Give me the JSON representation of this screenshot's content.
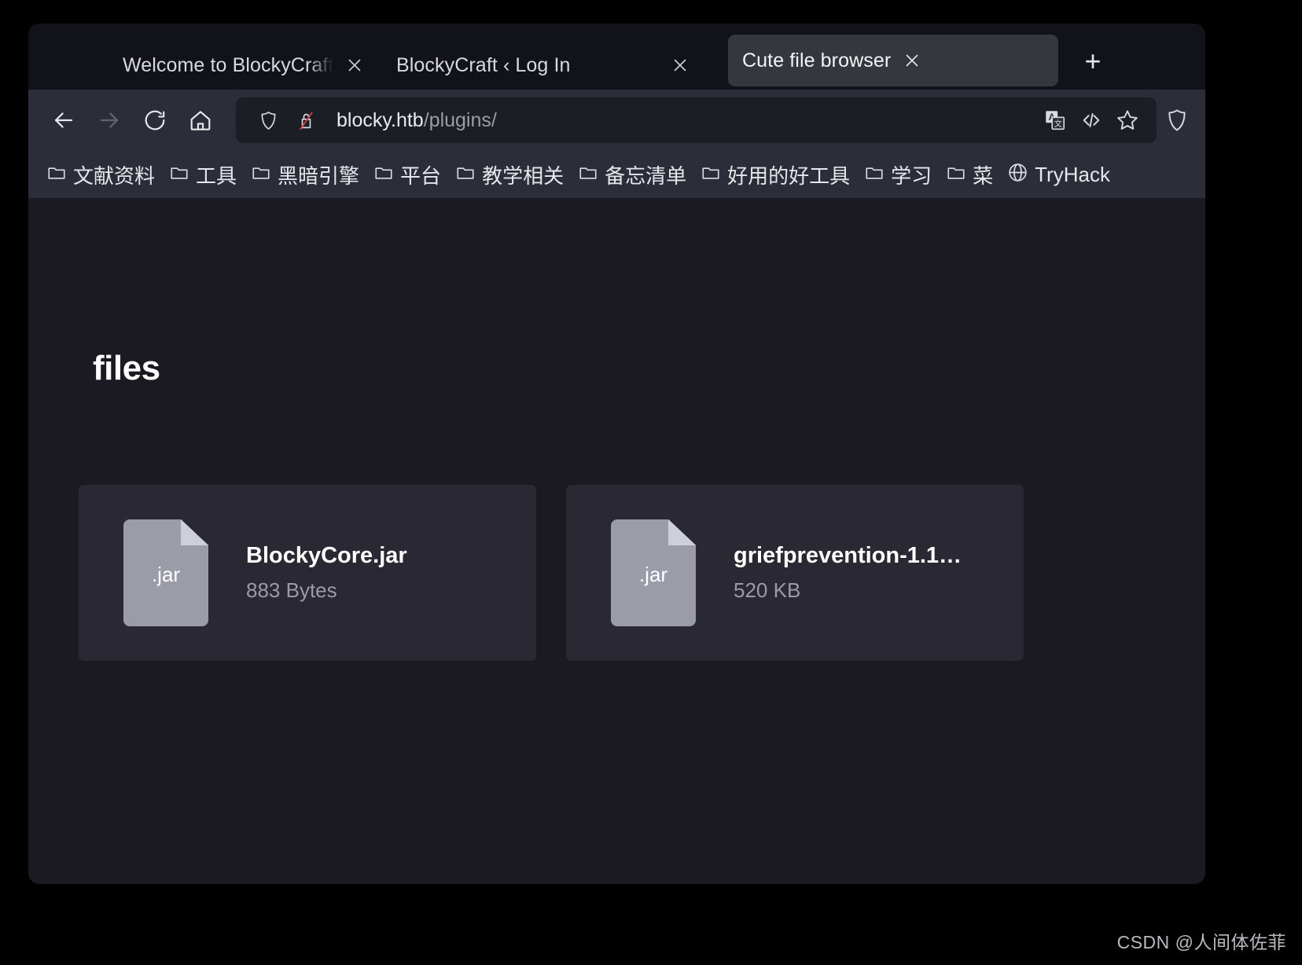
{
  "browser": {
    "tabs": [
      {
        "title": "Welcome to BlockyCraft! – Bl",
        "active": false,
        "close_icon": "close-icon"
      },
      {
        "title": "BlockyCraft ‹ Log In",
        "active": false,
        "close_icon": "close-icon"
      },
      {
        "title": "Cute file browser",
        "active": true,
        "close_icon": "close-icon"
      }
    ],
    "new_tab_label": "+",
    "nav": {
      "back": "back-arrow-icon",
      "forward": "forward-arrow-icon",
      "reload": "reload-icon",
      "home": "home-icon"
    },
    "url": {
      "host": "blocky.htb",
      "path": "/plugins/",
      "shield_icon": "tracking-protection-shield-icon",
      "lock_icon": "insecure-connection-padlock-icon"
    },
    "url_actions": {
      "translate": "translate-page-icon",
      "reader": "code-view-icon",
      "bookmark": "bookmark-star-icon"
    },
    "bookmarks": [
      {
        "label": "文献资料",
        "icon": "folder-icon"
      },
      {
        "label": "工具",
        "icon": "folder-icon"
      },
      {
        "label": "黑暗引擎",
        "icon": "folder-icon"
      },
      {
        "label": "平台",
        "icon": "folder-icon"
      },
      {
        "label": "教学相关",
        "icon": "folder-icon"
      },
      {
        "label": "备忘清单",
        "icon": "folder-icon"
      },
      {
        "label": "好用的好工具",
        "icon": "folder-icon"
      },
      {
        "label": "学习",
        "icon": "folder-icon"
      },
      {
        "label": "菜",
        "icon": "folder-icon"
      },
      {
        "label": "TryHack",
        "icon": "globe-icon"
      }
    ]
  },
  "page": {
    "title": "files",
    "files": [
      {
        "name": "BlockyCore.jar",
        "size": "883 Bytes",
        "ext": ".jar"
      },
      {
        "name": "griefprevention-1.1…",
        "size": "520 KB",
        "ext": ".jar"
      }
    ]
  },
  "watermark": "CSDN @人间体佐菲",
  "colors": {
    "window_bg": "#12131a",
    "toolbar_bg": "#2b2e38",
    "urlbar_bg": "#1c1e26",
    "active_tab_bg": "#35373e",
    "page_bg": "#1b1a23",
    "card_bg": "#2a2832",
    "file_icon": "#9a9da8",
    "text_primary": "#ffffff",
    "text_muted": "#9a9ba6"
  }
}
